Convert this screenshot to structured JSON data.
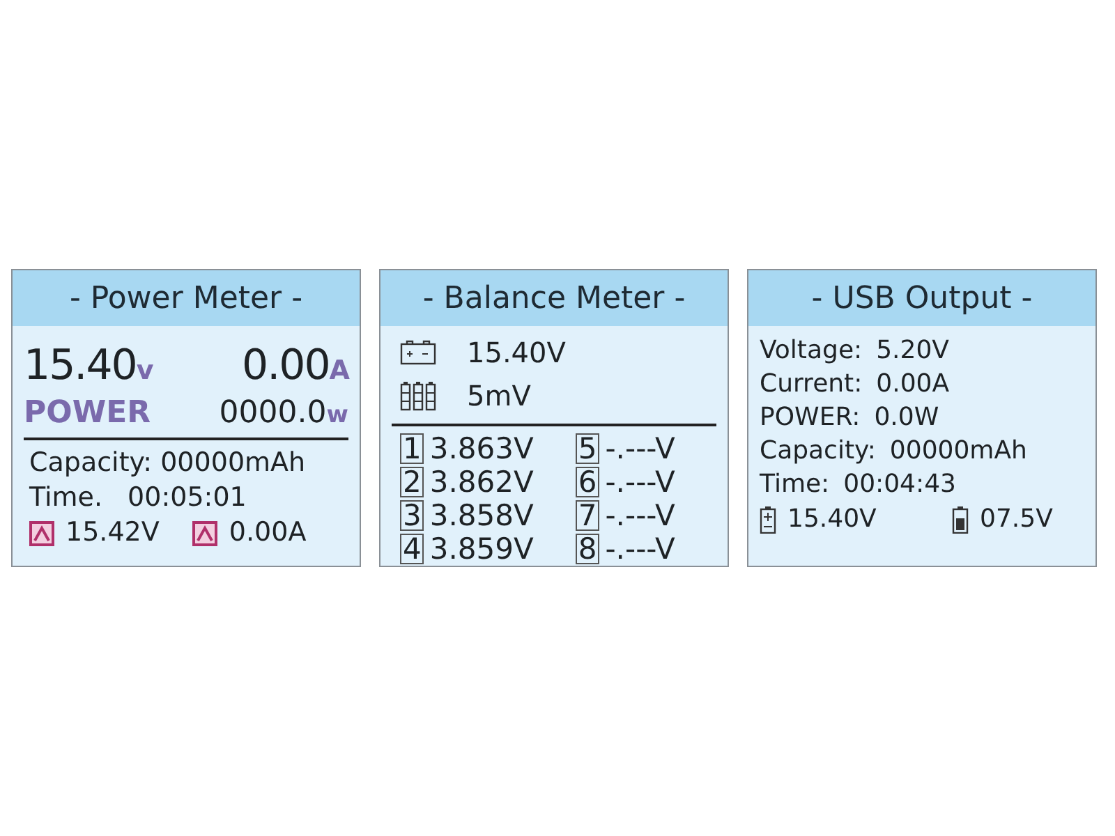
{
  "power_meter": {
    "title": "- Power Meter -",
    "voltage": {
      "value": "15.40",
      "unit": "v"
    },
    "current": {
      "value": "0.00",
      "unit": "A"
    },
    "power": {
      "label": "POWER",
      "value": "0000.0",
      "unit": "w"
    },
    "capacity": "Capacity: 00000mAh",
    "time": {
      "label": "Time.",
      "value": "00:05:01"
    },
    "limits": [
      {
        "value": "15.42V"
      },
      {
        "value": "0.00A"
      }
    ]
  },
  "balance_meter": {
    "title": "- Balance Meter -",
    "total": "15.40V",
    "difference": "5mV",
    "cells": [
      {
        "index": "1",
        "value": "3.863V"
      },
      {
        "index": "2",
        "value": "3.862V"
      },
      {
        "index": "3",
        "value": "3.858V"
      },
      {
        "index": "4",
        "value": "3.859V"
      },
      {
        "index": "5",
        "value": "-.---V"
      },
      {
        "index": "6",
        "value": "-.---V"
      },
      {
        "index": "7",
        "value": "-.---V"
      },
      {
        "index": "8",
        "value": "-.---V"
      }
    ]
  },
  "usb_output": {
    "title": "- USB Output -",
    "rows": [
      {
        "label": "Voltage:",
        "value": "5.20V"
      },
      {
        "label": "Current:",
        "value": "0.00A"
      },
      {
        "label": "POWER:",
        "value": "0.0W"
      },
      {
        "label": "Capacity:",
        "value": "00000mAh"
      },
      {
        "label": "Time:",
        "value": "00:04:43"
      }
    ],
    "input": "15.40V",
    "battery": "07.5V"
  }
}
